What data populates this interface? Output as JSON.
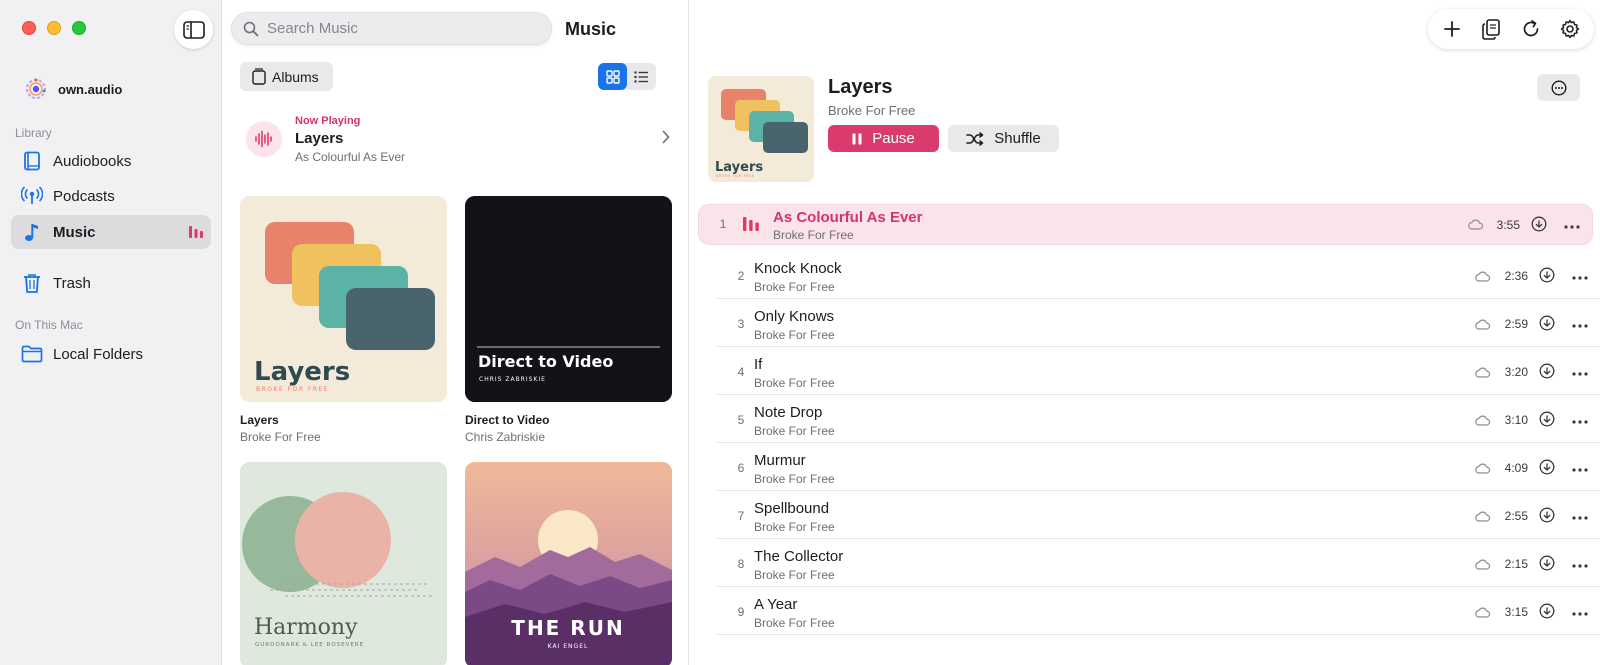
{
  "sidebar": {
    "brand": "own.audio",
    "library_label": "Library",
    "items": [
      {
        "label": "Audiobooks",
        "icon": "book-icon"
      },
      {
        "label": "Podcasts",
        "icon": "podcast-icon"
      },
      {
        "label": "Music",
        "icon": "music-note-icon",
        "active": true
      },
      {
        "label": "Trash",
        "icon": "trash-icon"
      }
    ],
    "on_this_mac_label": "On This Mac",
    "local_folders": "Local Folders"
  },
  "middle": {
    "search_placeholder": "Search Music",
    "title": "Music",
    "albums_button": "Albums",
    "now_playing": {
      "label": "Now Playing",
      "title": "Layers",
      "subtitle": "As Colourful As Ever"
    },
    "albums": [
      {
        "title": "Layers",
        "artist": "Broke For Free",
        "cover_text": "Layers",
        "cover_sub": "BROKE FOR FREE"
      },
      {
        "title": "Direct to Video",
        "artist": "Chris Zabriskie",
        "cover_text": "Direct to Video",
        "cover_sub": "CHRIS ZABRISKIE"
      },
      {
        "title": "",
        "artist": "",
        "cover_text": "Harmony",
        "cover_sub": "GURDONARK & LEE ROSEVERE"
      },
      {
        "title": "",
        "artist": "",
        "cover_text": "THE RUN",
        "cover_sub": "KAI ENGEL"
      }
    ]
  },
  "album": {
    "title": "Layers",
    "artist": "Broke For Free",
    "cover_text": "Layers",
    "cover_sub": "BROKE FOR FREE",
    "pause_label": "Pause",
    "shuffle_label": "Shuffle"
  },
  "tracks": [
    {
      "num": "1",
      "title": "As Colourful As Ever",
      "artist": "Broke For Free",
      "duration": "3:55",
      "playing": true
    },
    {
      "num": "2",
      "title": "Knock Knock",
      "artist": "Broke For Free",
      "duration": "2:36"
    },
    {
      "num": "3",
      "title": "Only Knows",
      "artist": "Broke For Free",
      "duration": "2:59"
    },
    {
      "num": "4",
      "title": "If",
      "artist": "Broke For Free",
      "duration": "3:20"
    },
    {
      "num": "5",
      "title": "Note Drop",
      "artist": "Broke For Free",
      "duration": "3:10"
    },
    {
      "num": "6",
      "title": "Murmur",
      "artist": "Broke For Free",
      "duration": "4:09"
    },
    {
      "num": "7",
      "title": "Spellbound",
      "artist": "Broke For Free",
      "duration": "2:55"
    },
    {
      "num": "8",
      "title": "The Collector",
      "artist": "Broke For Free",
      "duration": "2:15"
    },
    {
      "num": "9",
      "title": "A Year",
      "artist": "Broke For Free",
      "duration": "3:15"
    }
  ],
  "colors": {
    "accent": "#db3a6c",
    "selection": "#1a73e8",
    "playing_row": "#fbe3ea"
  },
  "toolbar_icons": [
    "plus-icon",
    "copy-icon",
    "refresh-icon",
    "gear-icon"
  ]
}
